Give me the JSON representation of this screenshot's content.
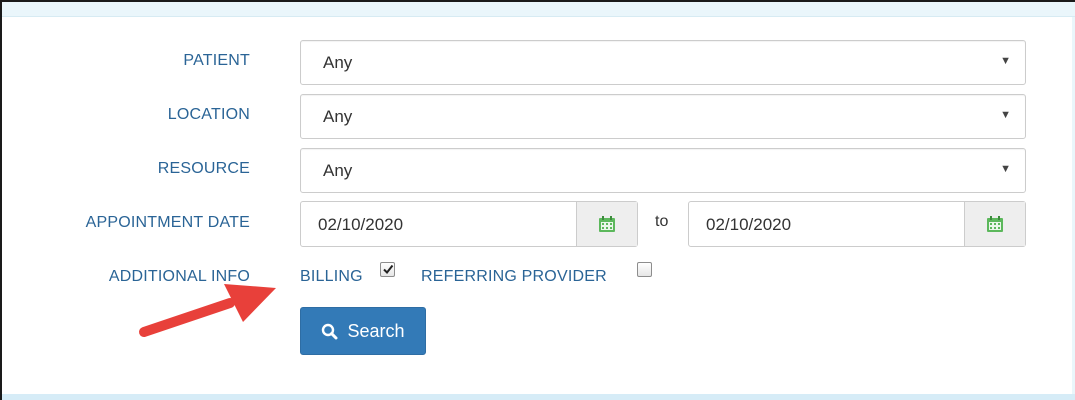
{
  "filters": {
    "patient": {
      "label": "PATIENT",
      "value": "Any"
    },
    "location": {
      "label": "LOCATION",
      "value": "Any"
    },
    "resource": {
      "label": "RESOURCE",
      "value": "Any"
    },
    "appointment_date": {
      "label": "APPOINTMENT DATE",
      "from": "02/10/2020",
      "to_text": "to",
      "to": "02/10/2020"
    },
    "additional_info": {
      "label": "ADDITIONAL INFO",
      "billing": {
        "label": "BILLING",
        "checked": true
      },
      "referring_provider": {
        "label": "REFERRING PROVIDER",
        "checked": false
      }
    }
  },
  "search_button": {
    "label": "Search",
    "icon": "search-icon"
  },
  "annotation": {
    "icon": "red-arrow-icon",
    "color": "#e8403a"
  },
  "colors": {
    "label": "#2a6496",
    "button": "#337ab7",
    "calendar": "#5cb85c"
  }
}
